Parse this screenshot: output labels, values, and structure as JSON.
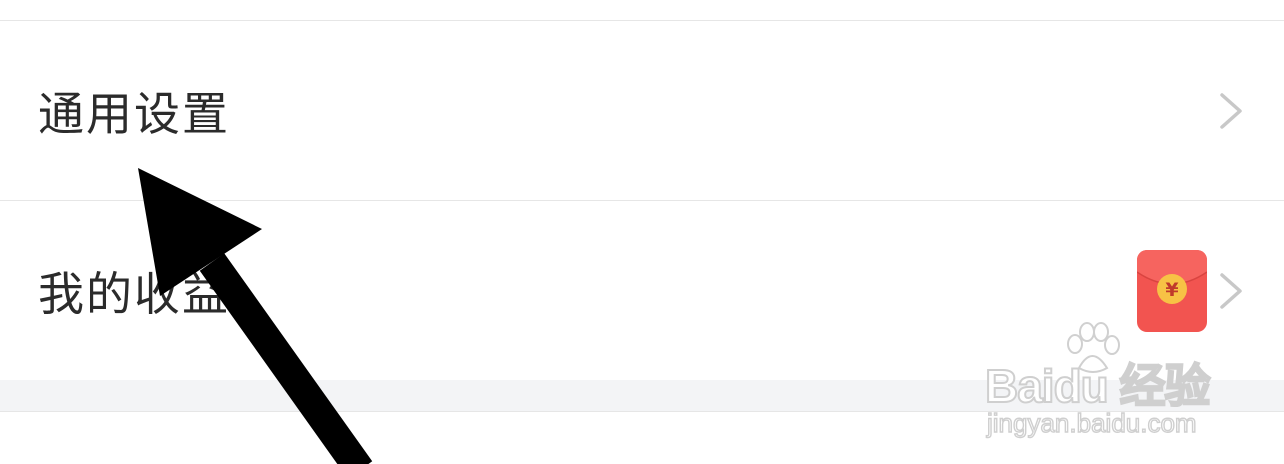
{
  "settings_list": {
    "rows": [
      {
        "label": "通用设置",
        "icon": "chevron-right-icon"
      },
      {
        "label": "我的收益",
        "badge_icon": "red-envelope-icon",
        "badge_symbol": "¥",
        "icon": "chevron-right-icon"
      }
    ]
  },
  "watermark": {
    "brand": "Baidu 经验",
    "url": "jingyan.baidu.com"
  },
  "annotation": {
    "icon": "black-arrow-icon",
    "color": "#000000"
  },
  "colors": {
    "badge_red": "#f25450",
    "badge_gold": "#f7c245",
    "divider": "#e6e6e6",
    "section_gap": "#f3f4f6",
    "chevron": "#c8c8c8"
  }
}
